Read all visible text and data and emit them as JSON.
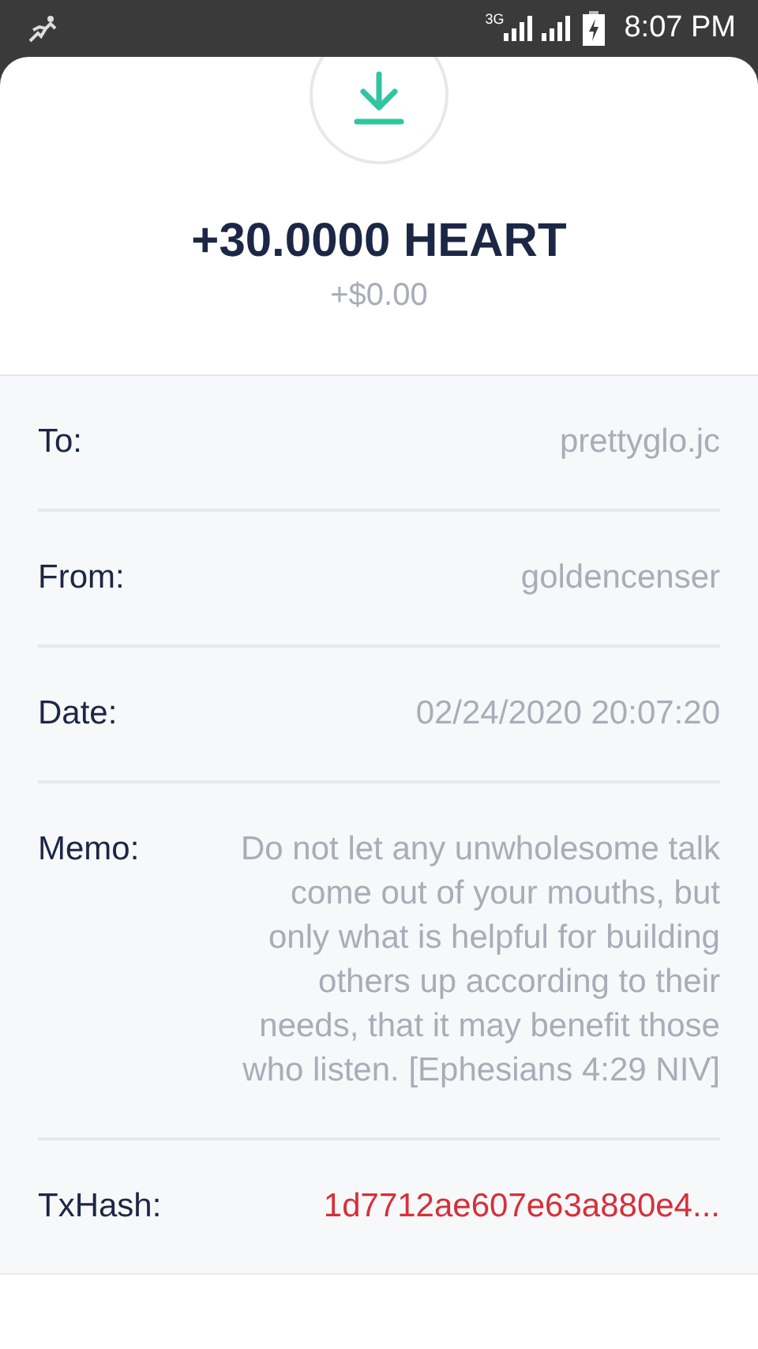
{
  "status_bar": {
    "network": "3G",
    "time": "8:07 PM"
  },
  "amount": "+30.0000 HEART",
  "fiat": "+$0.00",
  "details": [
    {
      "label": "To:",
      "value": "prettyglo.jc",
      "kind": "text"
    },
    {
      "label": "From:",
      "value": "goldencenser",
      "kind": "text"
    },
    {
      "label": "Date:",
      "value": "02/24/2020 20:07:20",
      "kind": "text"
    },
    {
      "label": "Memo:",
      "value": "Do not let any unwholesome talk come out of your mouths, but only what is helpful for building others up according to their needs, that it may benefit those who listen. [Ephesians 4:29 NIV]",
      "kind": "text"
    },
    {
      "label": "TxHash:",
      "value": "1d7712ae607e63a880e4...",
      "kind": "link"
    }
  ]
}
